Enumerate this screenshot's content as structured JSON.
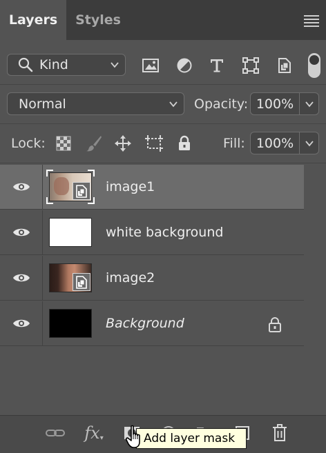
{
  "tabs": [
    {
      "label": "Layers",
      "active": true
    },
    {
      "label": "Styles",
      "active": false
    }
  ],
  "filter": {
    "kind_label": "Kind",
    "icons": [
      "image-filter-icon",
      "adjustment-filter-icon",
      "type-filter-icon",
      "shape-filter-icon",
      "smart-object-filter-icon"
    ]
  },
  "blend": {
    "mode": "Normal",
    "opacity_label": "Opacity:",
    "opacity_value": "100%"
  },
  "lock": {
    "label": "Lock:",
    "fill_label": "Fill:",
    "fill_value": "100%",
    "icons": [
      "lock-transparent-pixels-icon",
      "lock-image-pixels-icon",
      "lock-position-icon",
      "lock-artboard-icon",
      "lock-all-icon"
    ]
  },
  "layers": [
    {
      "name": "image1",
      "selected": true,
      "italic": false,
      "smart_object": true,
      "locked": false,
      "thumb": "photo-faded"
    },
    {
      "name": "white background",
      "selected": false,
      "italic": false,
      "smart_object": false,
      "locked": false,
      "thumb": "white"
    },
    {
      "name": "image2",
      "selected": false,
      "italic": false,
      "smart_object": true,
      "locked": false,
      "thumb": "photo-face"
    },
    {
      "name": "Background",
      "selected": false,
      "italic": true,
      "smart_object": false,
      "locked": true,
      "thumb": "black"
    }
  ],
  "toolbar": {
    "icons": [
      "link-layers-icon",
      "fx-icon",
      "add-mask-icon",
      "adjustment-layer-icon",
      "group-folder-icon",
      "new-layer-icon",
      "delete-icon"
    ],
    "fx_label": "fx",
    "tooltip": "Add layer mask"
  },
  "colors": {
    "panel_bg": "#535353",
    "tab_bar_bg": "#3c3c3c",
    "selected_row_bg": "#6c6c6c",
    "tooltip_bg": "#ffffdf"
  }
}
